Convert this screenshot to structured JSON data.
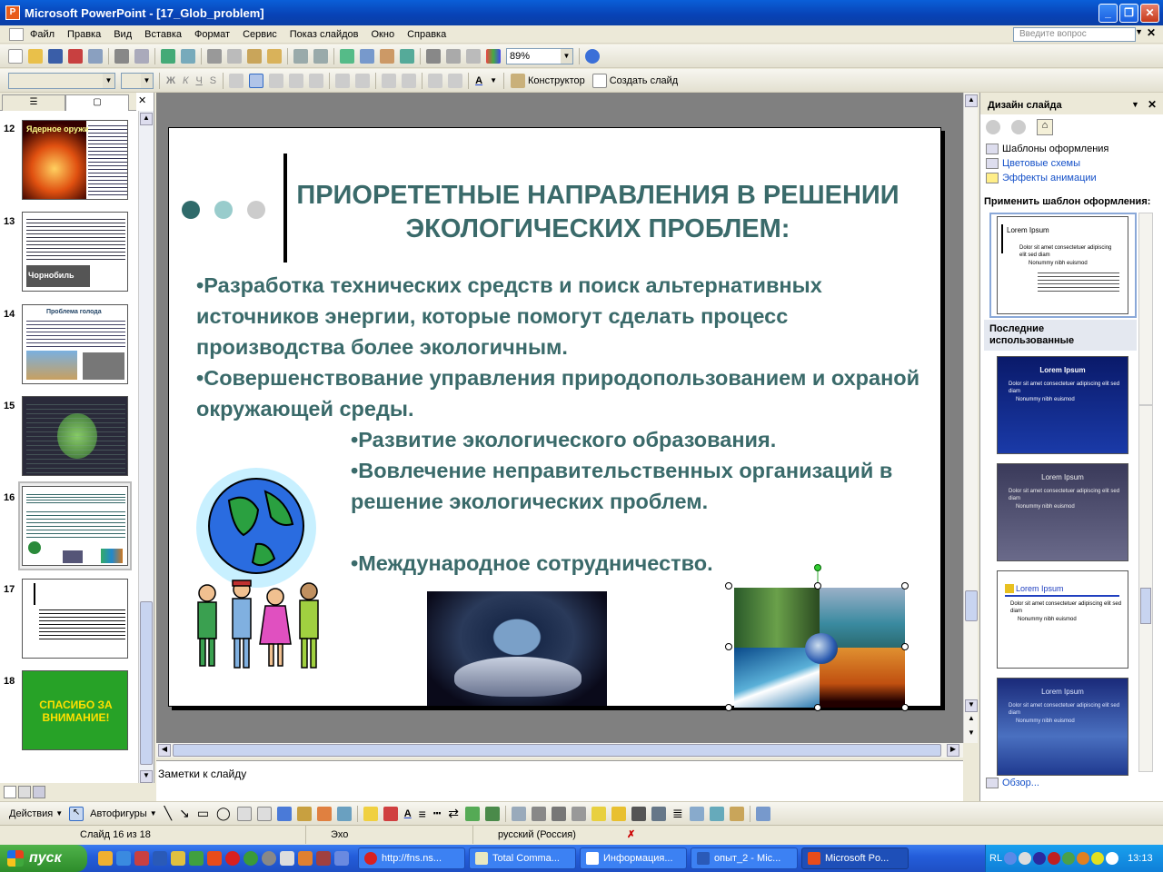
{
  "window": {
    "title": "Microsoft PowerPoint - [17_Glob_problem]",
    "app_icon": "powerpoint-icon"
  },
  "menu": {
    "items": [
      "Файл",
      "Правка",
      "Вид",
      "Вставка",
      "Формат",
      "Сервис",
      "Показ слайдов",
      "Окно",
      "Справка"
    ],
    "ask_placeholder": "Введите вопрос"
  },
  "toolbar": {
    "zoom": "89%",
    "designer_label": "Конструктор",
    "new_slide_label": "Создать слайд",
    "fmt_letters": [
      "Ж",
      "К",
      "Ч",
      "S"
    ]
  },
  "thumbs": {
    "items": [
      {
        "num": "12",
        "caption": "Ядерное оружие",
        "color": "#c03010"
      },
      {
        "num": "13",
        "caption": "Чорнобиль",
        "color": "#ffffff"
      },
      {
        "num": "14",
        "caption": "Проблема голода",
        "color": "#ffffff"
      },
      {
        "num": "15",
        "caption": "",
        "color": "#333344"
      },
      {
        "num": "16",
        "caption": "",
        "color": "#ffffff"
      },
      {
        "num": "17",
        "caption": "",
        "color": "#ffffff"
      },
      {
        "num": "18",
        "caption": "СПАСИБО ЗА ВНИМАНИЕ!",
        "color": "#27a227"
      }
    ]
  },
  "slide": {
    "title": "ПРИОРЕТЕТНЫЕ НАПРАВЛЕНИЯ В РЕШЕНИИ ЭКОЛОГИЧЕСКИХ ПРОБЛЕМ:",
    "bullets": [
      "•Разработка технических средств и поиск альтернативных источников энергии, которые помогут сделать процесс производства более экологичным.",
      "•Совершенствование управления природопользованием и охраной окружающей среды.",
      "•Развитие экологического образования.",
      "•Вовлечение неправительственных организаций в решение экологических проблем.",
      "•Международное сотрудничество."
    ],
    "dot_colors": [
      "#2f6a6a",
      "#99cccc",
      "#cccccc"
    ]
  },
  "notes": {
    "placeholder": "Заметки к слайду"
  },
  "taskpane": {
    "title": "Дизайн слайда",
    "links": [
      "Шаблоны оформления",
      "Цветовые схемы",
      "Эффекты анимации"
    ],
    "apply_label": "Применить шаблон оформления:",
    "recent_label": "Последние использованные",
    "designs": [
      {
        "title": "Lorem Ipsum",
        "bg": "#ffffff",
        "fg": "#000000"
      },
      {
        "title": "Lorem Ipsum",
        "bg": "#1a2a8a",
        "fg": "#ffffff"
      },
      {
        "title": "Lorem Ipsum",
        "bg": "#4a4a6a",
        "fg": "#dddddd"
      },
      {
        "title": "Lorem Ipsum",
        "bg": "#ffffff",
        "fg": "#2040c0"
      },
      {
        "title": "Lorem Ipsum",
        "bg": "#3050a0",
        "fg": "#dde6ff"
      }
    ],
    "bullet_text": "Dolor sit amet consectetuer adipiscing elit sed diam",
    "sub_text": "Nonummy nibh euismod",
    "browse_label": "Обзор..."
  },
  "drawbar": {
    "actions_label": "Действия",
    "autoshapes_label": "Автофигуры"
  },
  "status": {
    "slide": "Слайд 16 из 18",
    "design": "Эхо",
    "lang": "русский (Россия)"
  },
  "taskbar": {
    "start_label": "пуск",
    "tasks": [
      "http://fns.ns...",
      "Total Comma...",
      "Информация...",
      "опыт_2 - Mic...",
      "Microsoft Po..."
    ],
    "lang": "RL",
    "clock": "13:13"
  }
}
